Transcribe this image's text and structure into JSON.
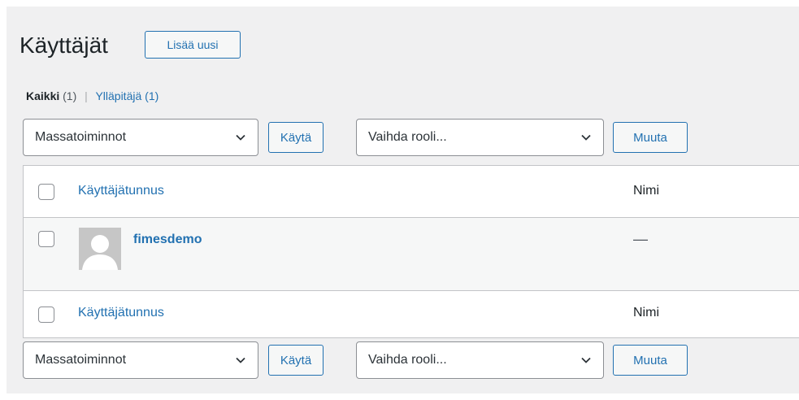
{
  "header": {
    "title": "Käyttäjät",
    "add_new_label": "Lisää uusi"
  },
  "filters": {
    "all_label": "Kaikki",
    "all_count": "(1)",
    "separator": "|",
    "admin_label": "Ylläpitäjä",
    "admin_count": "(1)"
  },
  "bulk_actions": {
    "select_value": "Massatoiminnot",
    "apply_label": "Käytä",
    "role_select_value": "Vaihda rooli...",
    "change_label": "Muuta"
  },
  "table": {
    "columns": {
      "username": "Käyttäjätunnus",
      "name": "Nimi"
    },
    "rows": [
      {
        "username": "fimesdemo",
        "name": "—"
      }
    ]
  }
}
